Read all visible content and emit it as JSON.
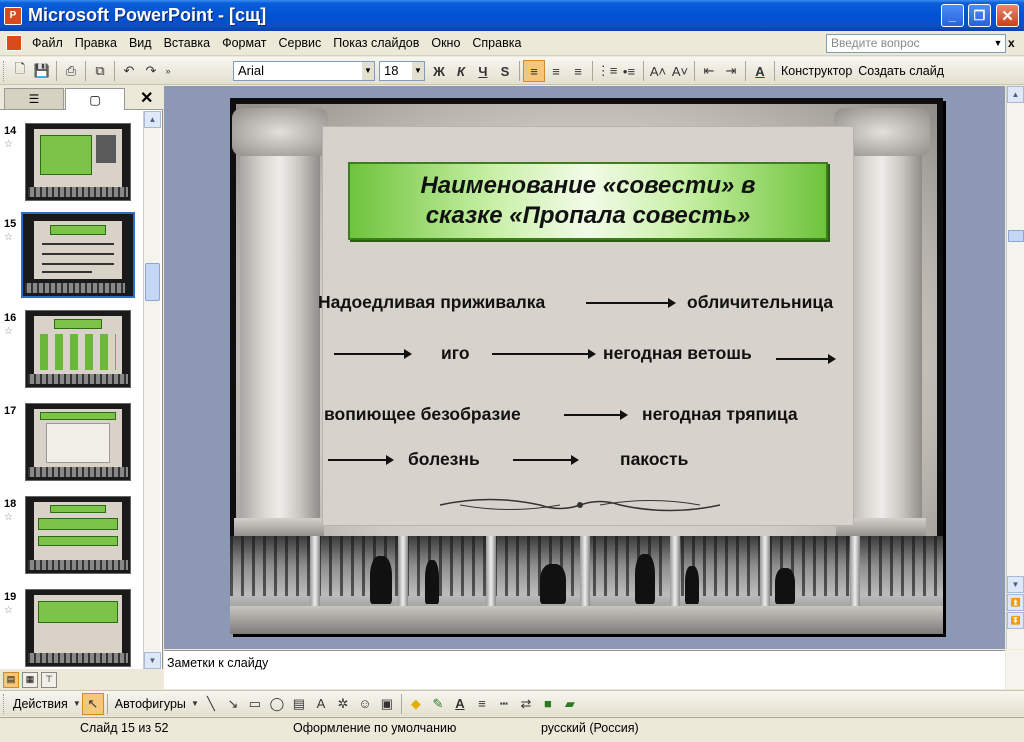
{
  "window": {
    "app_icon_letter": "P",
    "title": "Microsoft PowerPoint - [сщ]",
    "minimize": "_",
    "maximize": "❐",
    "close": "✕"
  },
  "menu": {
    "items": [
      "Файл",
      "Правка",
      "Вид",
      "Вставка",
      "Формат",
      "Сервис",
      "Показ слайдов",
      "Окно",
      "Справка"
    ],
    "help_placeholder": "Введите вопрос",
    "mdi_close": "x"
  },
  "toolbar": {
    "font_name": "Arial",
    "font_size": "18",
    "bold": "Ж",
    "italic": "К",
    "underline": "Ч",
    "shadow": "S",
    "design_label": "Конструктор",
    "new_slide_label": "Создать слайд",
    "icons": [
      "new-icon",
      "open-icon",
      "save-icon",
      "print-icon",
      "copy-icon",
      "undo-icon",
      "redo-icon"
    ]
  },
  "left_pane": {
    "close": "✕",
    "slides": [
      {
        "num": "14",
        "star": "☆"
      },
      {
        "num": "15",
        "star": "☆",
        "selected": true
      },
      {
        "num": "16",
        "star": "☆"
      },
      {
        "num": "17",
        "star": ""
      },
      {
        "num": "18",
        "star": "☆"
      },
      {
        "num": "19",
        "star": "☆"
      }
    ]
  },
  "slide": {
    "title_line1": "Наименование «совести» в",
    "title_line2": "сказке «Пропала совесть»",
    "words": {
      "w1": "Надоедливая приживалка",
      "w2": "обличительница",
      "w3": "иго",
      "w4": "негодная ветошь",
      "w5": "вопиющее безобразие",
      "w6": "негодная тряпица",
      "w7": "болезнь",
      "w8": "пакость"
    }
  },
  "notes": {
    "placeholder": "Заметки к слайду"
  },
  "drawing_toolbar": {
    "actions_label": "Действия",
    "autoshapes_label": "Автофигуры"
  },
  "status": {
    "slide_counter": "Слайд 15 из 52",
    "design": "Оформление по умолчанию",
    "language": "русский (Россия)"
  },
  "colors": {
    "titlebar": "#0052d4",
    "title_box_green": "#6ec43c",
    "slide_area_bg": "#8d98b5",
    "selection_blue": "#316ac5"
  }
}
